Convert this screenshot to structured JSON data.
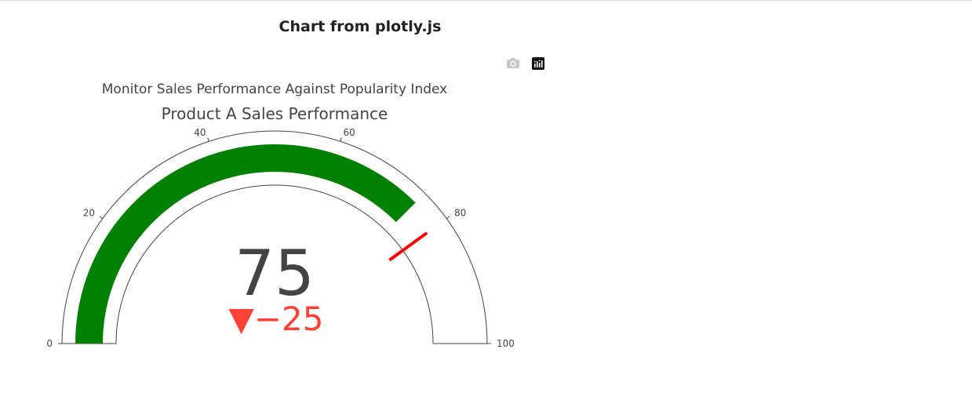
{
  "page": {
    "title": "Chart from plotly.js"
  },
  "modebar": {
    "items": [
      {
        "icon": "camera-icon"
      },
      {
        "icon": "plotly-logo-icon"
      }
    ]
  },
  "chart_data": {
    "type": "gauge",
    "title": "Monitor Sales Performance Against Popularity Index",
    "gauge_title": "Product A Sales Performance",
    "value": 75,
    "reference": 100,
    "delta": -25,
    "delta_text": "−25",
    "delta_symbol": "▼",
    "threshold": 80,
    "axis_range": [
      0,
      100
    ],
    "ticks": [
      0,
      20,
      40,
      60,
      80,
      100
    ],
    "tick_labels": [
      "0",
      "20",
      "40",
      "60",
      "80",
      "100"
    ],
    "colors": {
      "bar": "#008000",
      "threshold": "#ff0000",
      "delta": "#ff4136",
      "value_text": "#444444",
      "axis": "#444444"
    }
  }
}
